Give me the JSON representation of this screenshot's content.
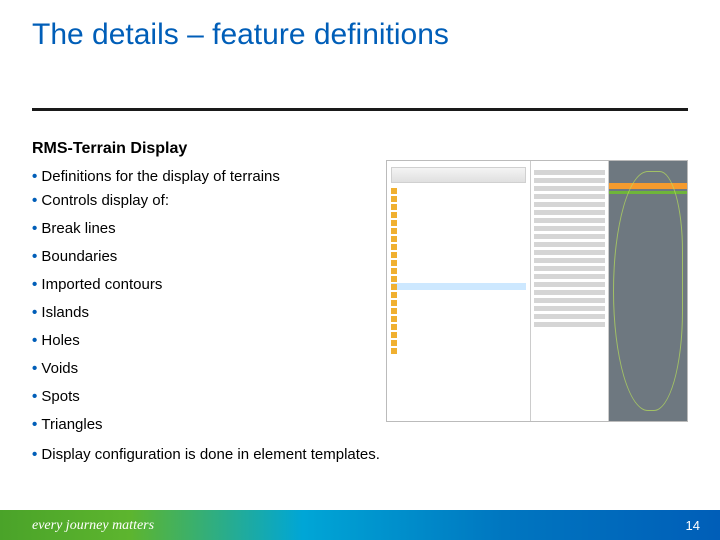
{
  "title": "The details – feature definitions",
  "subhead": "RMS-Terrain Display",
  "bullets": {
    "b1": "Definitions for the display of terrains",
    "b2": "Controls display of:",
    "sub": {
      "s1": "Break lines",
      "s2": "Boundaries",
      "s3": "Imported contours",
      "s4": "Islands",
      "s5": "Holes",
      "s6": "Voids",
      "s7": "Spots",
      "s8": "Triangles"
    },
    "b3": "Display configuration is done in element templates."
  },
  "footer": {
    "tagline": "every journey matters",
    "page": "14"
  }
}
